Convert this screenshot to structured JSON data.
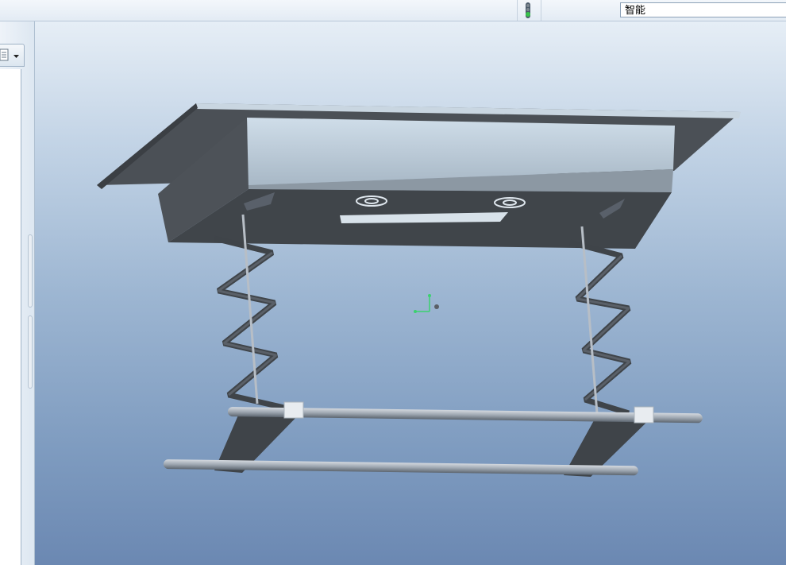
{
  "toolbar": {
    "filter_value": "智能",
    "status_light_icon": "traffic-light-icon"
  },
  "navigator": {
    "tab_icon": "model-tree-icon",
    "dropdown_icon": "chevron-down-icon"
  },
  "viewport": {
    "model": "scissor-lift-ceiling-projector-mount",
    "triad_icon": "coordinate-triad-icon",
    "colors": {
      "background_top": "#e6eef6",
      "background_bottom": "#6b88b2",
      "housing_top": "#c9d9e6",
      "housing_side": "#4a4f55",
      "rod": "#a9b1ba",
      "triad_green": "#3bd16f"
    }
  }
}
